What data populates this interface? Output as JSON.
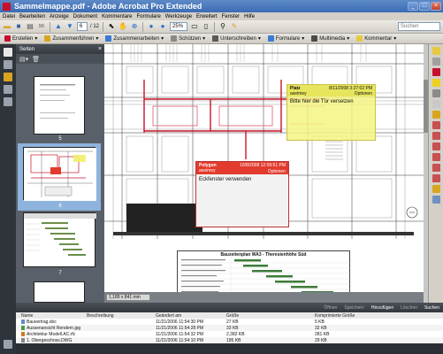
{
  "window": {
    "title": "Sammelmappe.pdf - Adobe Acrobat Pro Extended",
    "minimize": "_",
    "maximize": "□",
    "close": "×"
  },
  "menu": [
    "Datei",
    "Bearbeiten",
    "Anzeige",
    "Dokument",
    "Kommentare",
    "Formulare",
    "Werkzeuge",
    "Erweitert",
    "Fenster",
    "Hilfe"
  ],
  "toolbar": {
    "page_current": "6",
    "page_total": "/ 12",
    "zoom": "25%",
    "search_placeholder": "Suchen"
  },
  "tasks": {
    "create": "Erstellen",
    "combine": "Zusammenführen",
    "collaborate": "Zusammenarbeiten",
    "secure": "Schützen",
    "sign": "Unterschreiben",
    "forms": "Formulare",
    "multimedia": "Multimedia",
    "comment": "Kommentar"
  },
  "pages_panel": {
    "title": "Seiten",
    "thumbs": [
      {
        "num": "5"
      },
      {
        "num": "6"
      },
      {
        "num": "7"
      }
    ]
  },
  "notes": {
    "yellow": {
      "author": "Platz",
      "user": "aseimey",
      "date": "8/11/2008 3:27:02 PM",
      "options": "Optionen",
      "text": "Bitte hier die Tür versetzen"
    },
    "red": {
      "author": "Polygon",
      "user": "aseimey",
      "date": "10/8/2008 12:09:51 PM",
      "options": "Optionen",
      "text": "Eckfenster verwenden"
    }
  },
  "schedule": {
    "title": "Bauzeitenplan  WA3 - Theresienhöhe Süd"
  },
  "page_size": "1,189 x 841 mm",
  "attachments": {
    "tools": [
      "Öffnen",
      "Speichern",
      "Hinzufügen",
      "Löschen",
      "Suchen"
    ],
    "columns": [
      "Name",
      "Beschreibung",
      "Geändert am",
      "Größe",
      "Komprimierte Größe"
    ],
    "rows": [
      {
        "name": "Bauvertrag.doc",
        "desc": "",
        "modified": "11/21/2006 11:54:30 PM",
        "size": "27 KB",
        "csize": "5 KB"
      },
      {
        "name": "Aussenansicht Rendern.jpg",
        "desc": "",
        "modified": "11/21/2006 11:54:28 PM",
        "size": "33 KB",
        "csize": "32 KB"
      },
      {
        "name": "Architektur Modell.AC.rfc",
        "desc": "",
        "modified": "11/21/2006 11:54:32 PM",
        "size": "2,382 KB",
        "csize": "281 KB"
      },
      {
        "name": "1. Obergeschoss.DWG",
        "desc": "",
        "modified": "11/21/2006 11:54:10 PM",
        "size": "195 KB",
        "csize": "29 KB"
      }
    ]
  },
  "colors": {
    "title_bar": "#3b6cb3",
    "note_yellow": "#f5f582",
    "note_red": "#e23b2e",
    "panel_dark": "#2f343b"
  }
}
